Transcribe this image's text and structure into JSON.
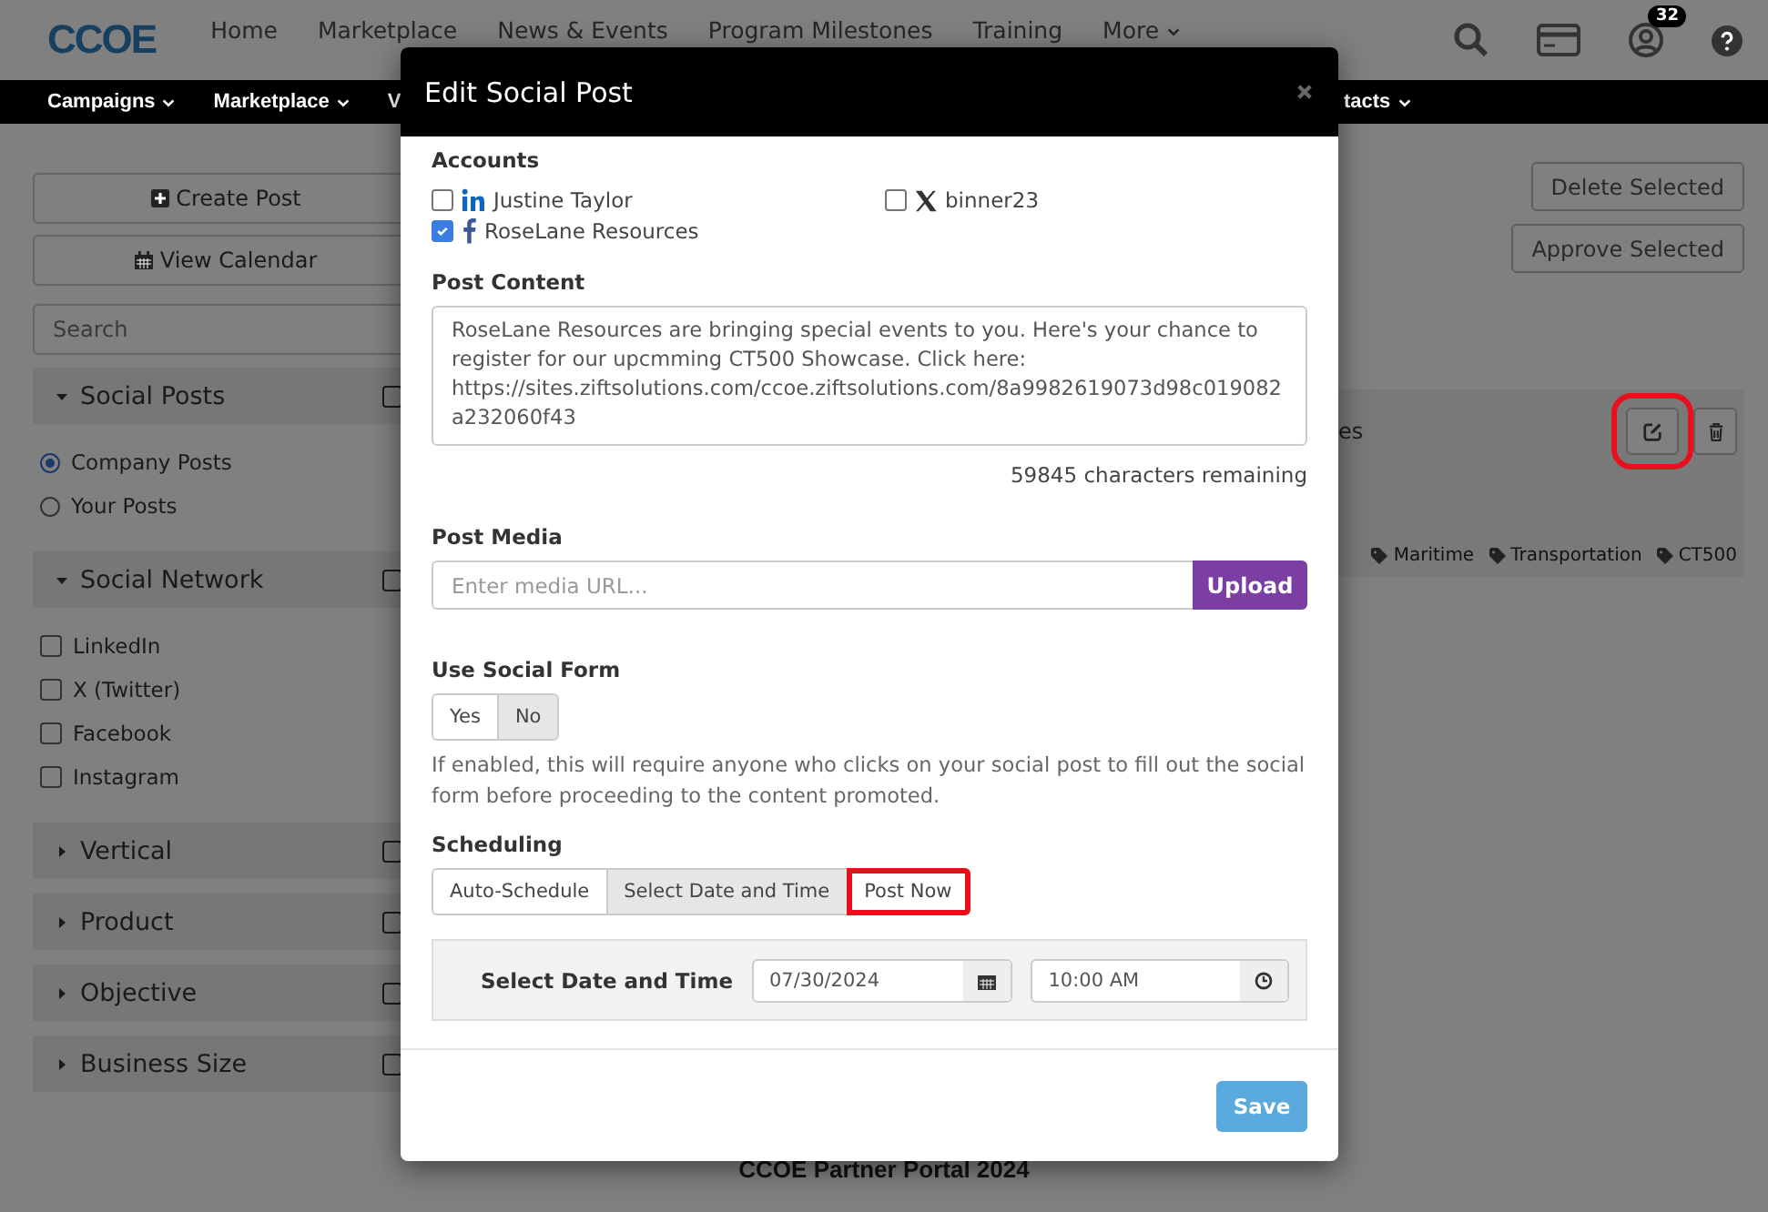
{
  "header": {
    "logo": "CCOE",
    "nav": [
      {
        "label": "Home",
        "caret": false
      },
      {
        "label": "Marketplace",
        "caret": false
      },
      {
        "label": "News & Events",
        "caret": false
      },
      {
        "label": "Program Milestones",
        "caret": false
      },
      {
        "label": "Training",
        "caret": false
      },
      {
        "label": "More",
        "caret": true
      }
    ],
    "notification_count": "32"
  },
  "subnav": {
    "left": [
      {
        "label": "Campaigns",
        "caret": true
      },
      {
        "label": "Marketplace",
        "caret": true
      },
      {
        "label": "V",
        "caret": false
      }
    ],
    "right": [
      {
        "label": "tacts",
        "caret": true
      }
    ]
  },
  "sidebar": {
    "buttons": [
      {
        "label": "Create Post",
        "kind": "create"
      },
      {
        "label": "View Calendar",
        "kind": "calendar"
      }
    ],
    "search": {
      "placeholder": "Search"
    },
    "sections": [
      {
        "title": "Social Posts",
        "expanded": true,
        "kind": "radio",
        "options": [
          {
            "label": "Company Posts",
            "selected": true
          },
          {
            "label": "Your Posts",
            "selected": false
          }
        ]
      },
      {
        "title": "Social Network",
        "expanded": true,
        "kind": "checkbox",
        "options": [
          {
            "label": "LinkedIn",
            "checked": false
          },
          {
            "label": "X (Twitter)",
            "checked": false
          },
          {
            "label": "Facebook",
            "checked": false
          },
          {
            "label": "Instagram",
            "checked": false
          }
        ]
      },
      {
        "title": "Vertical",
        "expanded": false
      },
      {
        "title": "Product",
        "expanded": false
      },
      {
        "title": "Objective",
        "expanded": false
      },
      {
        "title": "Business Size",
        "expanded": false
      }
    ]
  },
  "actions": [
    "Delete Selected",
    "Approve Selected"
  ],
  "post_card": {
    "title": "es",
    "actions": [
      {
        "kind": "edit",
        "highlighted": true
      },
      {
        "kind": "delete",
        "highlighted": false
      }
    ],
    "tags": [
      "Maritime",
      "Transportation",
      "CT500"
    ]
  },
  "footer": "CCOE Partner Portal 2024",
  "modal": {
    "title": "Edit Social Post",
    "accounts_label": "Accounts",
    "accounts": [
      {
        "name": "Justine Taylor",
        "kind": "linkedin",
        "checked": false
      },
      {
        "name": "binner23",
        "kind": "x",
        "checked": false
      },
      {
        "name": "RoseLane Resources",
        "kind": "facebook",
        "checked": true
      }
    ],
    "post_content": {
      "label": "Post Content",
      "value": "RoseLane Resources  are bringing special events to you. Here's your chance to register for our upcmming CT500 Showcase. Click here: https://sites.ziftsolutions.com/ccoe.ziftsolutions.com/8a9982619073d98c019082a232060f43",
      "remaining": "59845 characters remaining"
    },
    "post_media": {
      "label": "Post Media",
      "placeholder": "Enter media URL...",
      "button": "Upload"
    },
    "social_form": {
      "label": "Use Social Form",
      "options": [
        {
          "label": "Yes",
          "selected": false
        },
        {
          "label": "No",
          "selected": true
        }
      ],
      "help": "If enabled, this will require anyone who clicks on your social post to fill out the social form before proceeding to the content promoted."
    },
    "scheduling": {
      "label": "Scheduling",
      "options": [
        {
          "label": "Auto-Schedule",
          "selected": false,
          "highlighted": false
        },
        {
          "label": "Select Date and Time",
          "selected": true,
          "highlighted": false
        },
        {
          "label": "Post Now",
          "selected": false,
          "highlighted": true
        }
      ],
      "datetime": {
        "label": "Select Date and Time",
        "date": "07/30/2024",
        "time": "10:00 AM"
      }
    },
    "save": "Save"
  }
}
